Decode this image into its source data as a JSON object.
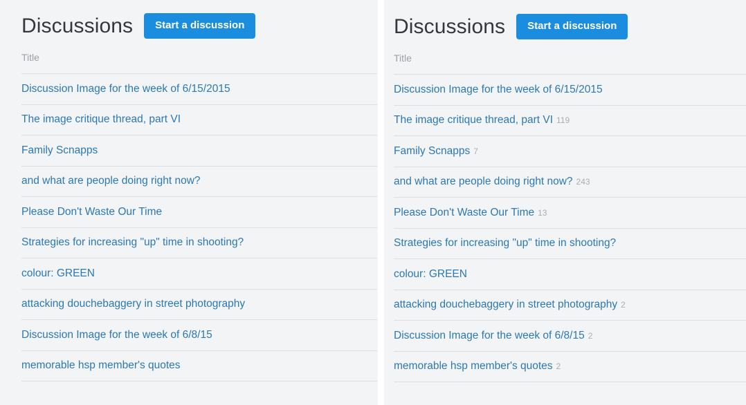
{
  "panels": [
    {
      "id": "left",
      "header": {
        "title": "Discussions",
        "start_button_label": "Start a discussion"
      },
      "table": {
        "column_header": "Title",
        "rows": [
          {
            "title": "Discussion Image for the week of 6/15/2015",
            "count": ""
          },
          {
            "title": "The image critique thread, part VI",
            "count": ""
          },
          {
            "title": "Family Scnapps",
            "count": ""
          },
          {
            "title": "and what are people doing right now?",
            "count": ""
          },
          {
            "title": "Please Don't Waste Our Time",
            "count": ""
          },
          {
            "title": "Strategies for increasing \"up\" time in shooting?",
            "count": ""
          },
          {
            "title": "colour: GREEN",
            "count": ""
          },
          {
            "title": "attacking douchebaggery in street photography",
            "count": ""
          },
          {
            "title": "Discussion Image for the week of 6/8/15",
            "count": ""
          },
          {
            "title": "memorable hsp member's quotes",
            "count": ""
          }
        ]
      }
    },
    {
      "id": "right",
      "header": {
        "title": "Discussions",
        "start_button_label": "Start a discussion"
      },
      "table": {
        "column_header": "Title",
        "rows": [
          {
            "title": "Discussion Image for the week of 6/15/2015",
            "count": ""
          },
          {
            "title": "The image critique thread, part VI",
            "count": "119"
          },
          {
            "title": "Family Scnapps",
            "count": "7"
          },
          {
            "title": "and what are people doing right now?",
            "count": "243"
          },
          {
            "title": "Please Don't Waste Our Time",
            "count": "13"
          },
          {
            "title": "Strategies for increasing \"up\" time in shooting?",
            "count": ""
          },
          {
            "title": "colour: GREEN",
            "count": ""
          },
          {
            "title": "attacking douchebaggery in street photography",
            "count": "2"
          },
          {
            "title": "Discussion Image for the week of 6/8/15",
            "count": "2"
          },
          {
            "title": "memorable hsp member's quotes",
            "count": "2"
          }
        ]
      }
    }
  ],
  "colors": {
    "panel_background": "#f3f4f6",
    "gutter_background": "#ffffff",
    "heading_text": "#34383c",
    "link_text": "#2b78b4",
    "muted_text": "#9ba1a7",
    "count_text": "#a9aeb3",
    "divider": "#dcdee0",
    "button_background": "#1b8ddf",
    "button_text": "#ffffff"
  }
}
